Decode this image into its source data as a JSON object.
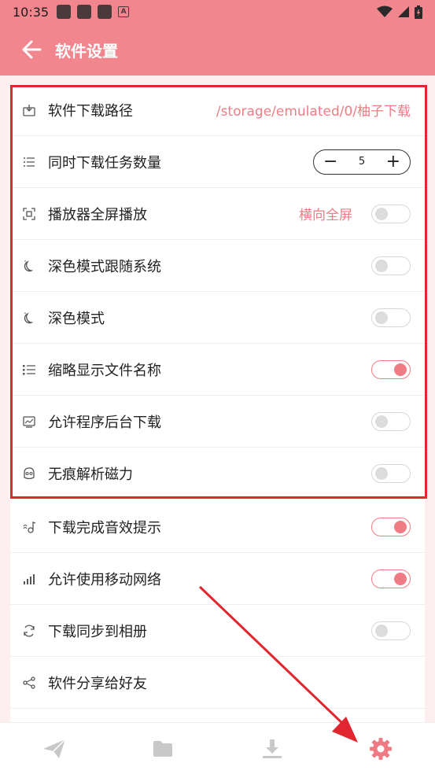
{
  "status_bar": {
    "time": "10:35"
  },
  "app_bar": {
    "title": "软件设置"
  },
  "settings": {
    "download_path": {
      "label": "软件下载路径",
      "value": "/storage/emulated/0/柚子下载"
    },
    "concurrent": {
      "label": "同时下载任务数量",
      "value": "5",
      "minus": "−",
      "plus": "+"
    },
    "fullscreen": {
      "label": "播放器全屏播放",
      "value": "横向全屏",
      "on": false
    },
    "dark_follow": {
      "label": "深色模式跟随系统",
      "on": false
    },
    "dark_mode": {
      "label": "深色模式",
      "on": false
    },
    "short_names": {
      "label": "缩略显示文件名称",
      "on": true
    },
    "background_dl": {
      "label": "允许程序后台下载",
      "on": false
    },
    "incognito_magnet": {
      "label": "无痕解析磁力",
      "on": false
    },
    "sound_hint": {
      "label": "下载完成音效提示",
      "on": true
    },
    "mobile_network": {
      "label": "允许使用移动网络",
      "on": true
    },
    "sync_album": {
      "label": "下载同步到相册",
      "on": false
    },
    "share": {
      "label": "软件分享给好友"
    }
  },
  "bottom_nav": [
    {
      "name": "send",
      "active": false
    },
    {
      "name": "folder",
      "active": false
    },
    {
      "name": "download",
      "active": false
    },
    {
      "name": "settings",
      "active": true
    }
  ],
  "colors": {
    "accent": "#ef7b84",
    "appbar": "#f2868e",
    "highlight": "#e0262f",
    "inactive_nav": "#c8c8c8"
  }
}
